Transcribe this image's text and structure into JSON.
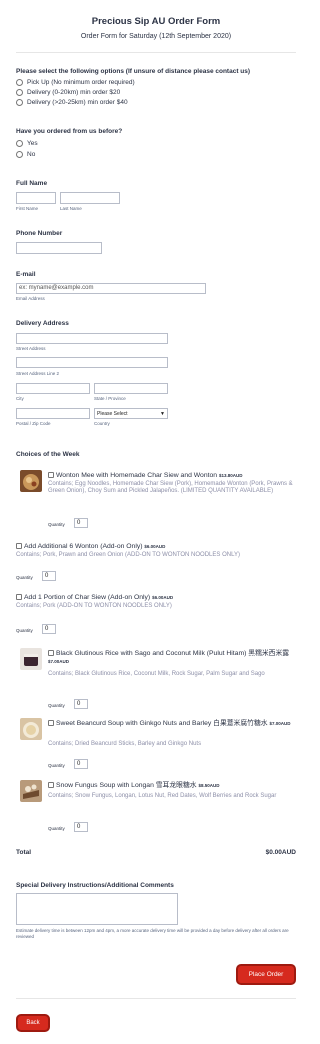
{
  "form": {
    "title": "Precious Sip AU Order Form",
    "subtitle": "Order Form for Saturday (12th September 2020)"
  },
  "delivery_option": {
    "question": "Please select the following options (If unsure of distance please contact us)",
    "options": [
      "Pick Up (No minimum order required)",
      "Delivery (0-20km) min order $20",
      "Delivery (>20-25km) min order $40"
    ]
  },
  "ordered_before": {
    "question": "Have you ordered from us before?",
    "options": [
      "Yes",
      "No"
    ]
  },
  "full_name": {
    "label": "Full Name",
    "first_sub": "First Name",
    "last_sub": "Last Name"
  },
  "phone": {
    "label": "Phone Number"
  },
  "email": {
    "label": "E-mail",
    "placeholder": "ex: myname@example.com",
    "sub": "Email Address"
  },
  "address": {
    "label": "Delivery Address",
    "street_sub": "Street Address",
    "street2_sub": "Street Address Line 2",
    "city_sub": "City",
    "state_sub": "State / Province",
    "postal_sub": "Postal / Zip Code",
    "country_sub": "Country",
    "country_value": "Please Select"
  },
  "products": {
    "heading": "Choices of the Week",
    "quantity_label": "Quantity",
    "items": [
      {
        "name": "Wonton Mee with Homemade Char Siew and Wonton",
        "price": "$13.80AUD",
        "desc": "Contains; Egg Noodles, Homemade Char Siew (Pork), Homemade Wonton (Pork, Prawns & Green Onion), Choy Sum and Pickled Jalapeños. (LIMITED QUANTITY AVAILABLE)",
        "qty": "0"
      },
      {
        "name": "Add Additional 6 Wonton (Add-on Only)",
        "price": "$6.00AUD",
        "desc": "Contains; Pork, Prawn and Green Onion (ADD-ON TO WONTON NOODLES ONLY)",
        "qty": "0"
      },
      {
        "name": "Add 1 Portion of Char Siew (Add-on Only)",
        "price": "$6.00AUD",
        "desc": "Contains; Pork (ADD-ON TO WONTON NOODLES ONLY)",
        "qty": "0"
      },
      {
        "name": "Black Glutinous Rice with Sago and Coconut Milk (Pulut Hitam) 黑糯米西米露",
        "price": "$7.00AUD",
        "desc": "Contains; Black Glutinous Rice, Coconut Milk, Rock Sugar, Palm Sugar and Sago",
        "qty": "0"
      },
      {
        "name": "Sweet Beancurd Soup with Ginkgo Nuts and Barley 白果薏米腐竹糖水",
        "price": "$7.00AUD",
        "desc": "Contains; Dried Beancurd Sticks, Barley and Ginkgo Nuts",
        "qty": "0"
      },
      {
        "name": "Snow Fungus Soup with Longan 雪耳龙眼糖水",
        "price": "$8.50AUD",
        "desc": "Contains; Snow Fungus, Longan, Lotus Nut, Red Dates, Wolf Berries and Rock Sugar",
        "qty": "0"
      }
    ],
    "total_label": "Total",
    "total_value": "$0.00AUD"
  },
  "comments": {
    "label": "Special Delivery Instructions/Additional Comments",
    "note": "Estimate delivery time is between 12pm and 4pm, a more accurate delivery time will be provided a day before delivery after all orders are reviewed"
  },
  "buttons": {
    "place_order": "Place Order",
    "back": "Back"
  }
}
